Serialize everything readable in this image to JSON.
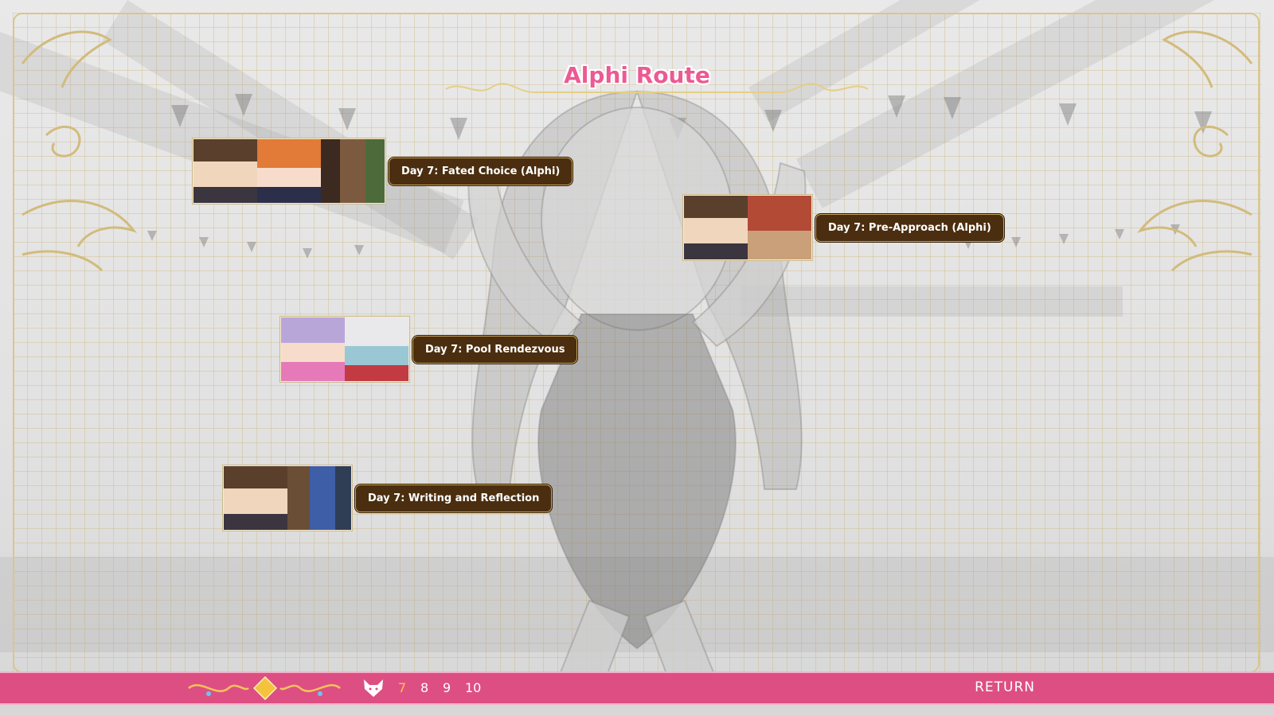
{
  "title": "Alphi Route",
  "nodes": [
    {
      "label": "Day 7: Fated Choice (Alphi)",
      "thumbnails": [
        "male-protagonist-portrait",
        "orange-hair-girl-portrait",
        "room-interior-scene"
      ]
    },
    {
      "label": "Day 7: Pre-Approach (Alphi)",
      "thumbnails": [
        "male-protagonist-portrait",
        "locker-room-scene"
      ]
    },
    {
      "label": "Day 7: Pool Rendezvous",
      "thumbnails": [
        "purple-hair-girl-portrait",
        "indoor-pool-scene"
      ]
    },
    {
      "label": "Day 7: Writing and Reflection",
      "thumbnails": [
        "male-protagonist-portrait",
        "bedroom-desk-scene"
      ]
    }
  ],
  "bottom_bar": {
    "days": [
      "7",
      "8",
      "9",
      "10"
    ],
    "active_day": "7",
    "return_label": "RETURN",
    "icons": [
      "ornament-left-icon",
      "diamond-gem-icon",
      "ornament-right-icon",
      "wolf-head-icon"
    ]
  },
  "colors": {
    "title_pink": "#ec5a93",
    "bar_pink": "#dd4f82",
    "label_brown": "#4a2e0f",
    "gold": "#d9c58f",
    "active_day": "#ffc44d"
  }
}
